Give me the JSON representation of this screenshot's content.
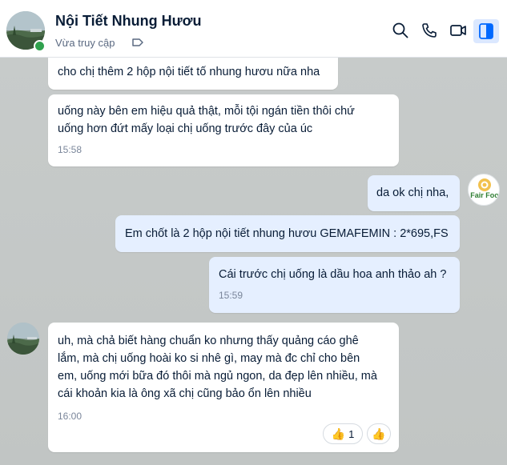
{
  "header": {
    "contact_name": "Nội Tiết Nhung Hươu",
    "status": "Vừa truy cập",
    "icons": [
      "search-icon",
      "phone-icon",
      "video-icon",
      "sidebar-panel-icon",
      "tag-icon"
    ]
  },
  "messages": [
    {
      "id": "m1",
      "side": "in",
      "text": "cho chị thêm 2 hộp nội tiết tố nhung hươu nữa nha",
      "time": ""
    },
    {
      "id": "m2",
      "side": "in",
      "text": "uống này bên em hiệu quả thật, mỗi tội ngán tiền thôi chứ\nuống hơn đứt mấy loại chị uống trước đây của úc",
      "time": "15:58"
    },
    {
      "id": "m3",
      "side": "out",
      "text": "da ok chị nha,",
      "time": ""
    },
    {
      "id": "m4",
      "side": "out",
      "text": "Em chốt là 2 hộp nội tiết nhung hươu GEMAFEMIN : 2*695,FS",
      "time": ""
    },
    {
      "id": "m5",
      "side": "out",
      "text": "Cái trước chị uống là dầu hoa anh thảo ah ?",
      "time": "15:59"
    },
    {
      "id": "m6",
      "side": "in",
      "text": "uh, mà chả biết hàng chuẩn ko nhưng thấy quảng cáo ghê\nlắm, mà chị uống hoài ko si nhê gì, may mà đc chỉ cho bên\nem, uống mới bữa đó thôi mà ngủ ngon, da đẹp lên nhiều, mà\ncái khoản kia là ông xã chị cũng bảo ổn lên nhiều",
      "time": "16:00"
    }
  ],
  "reactions": {
    "like_count": "1"
  },
  "brand_avatar_text": "Fair Foo",
  "colors": {
    "outgoing_bubble": "#e5efff",
    "incoming_bubble": "#ffffff",
    "accent": "#0068ff",
    "online": "#30a14e"
  }
}
